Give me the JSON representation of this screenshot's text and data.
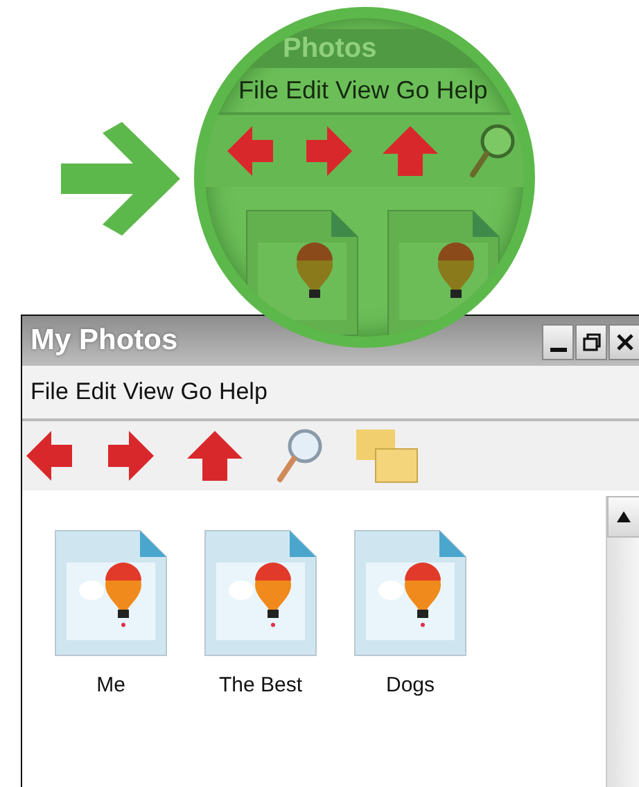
{
  "callout": {
    "title": "Photos",
    "menu": [
      "File",
      "Edit",
      "View",
      "Go",
      "Help"
    ],
    "files": [
      {
        "kind": "image"
      },
      {
        "kind": "image"
      }
    ]
  },
  "window": {
    "title": "My Photos",
    "menu": [
      "File",
      "Edit",
      "View",
      "Go",
      "Help"
    ],
    "files": [
      {
        "kind": "image",
        "name": "Me"
      },
      {
        "kind": "image",
        "name": "The Best"
      },
      {
        "kind": "image",
        "name": "Dogs"
      }
    ]
  }
}
